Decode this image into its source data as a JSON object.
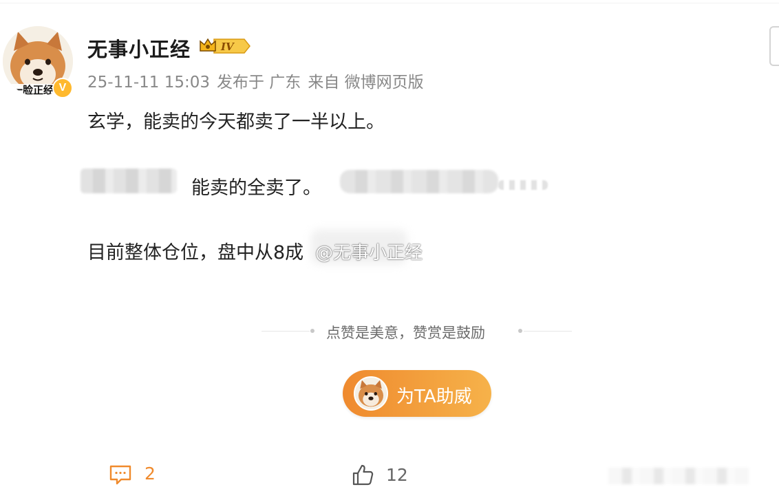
{
  "post": {
    "username": "无事小正经",
    "level_badge": "IV",
    "avatar_caption": "一脸正经",
    "verified_mark": "V",
    "meta": {
      "timestamp": "25-11-11 15:03",
      "location": "发布于 广东",
      "source": "来自 微博网页版"
    },
    "paragraphs": {
      "p1": "玄学，能卖的今天都卖了一半以上。",
      "p2": "能卖的全卖了。",
      "p3": "目前整体仓位，盘中从8成"
    },
    "watermark": "@无事小正经"
  },
  "reward": {
    "prompt": "点赞是美意，赞赏是鼓励",
    "button_label": "为TA助威"
  },
  "footer": {
    "comment_count": "2",
    "like_count": "12"
  },
  "colors": {
    "accent_orange": "#f08a2c",
    "badge_gold": "#ffb92e",
    "meta_gray": "#888888"
  },
  "icons": [
    "avatar-image",
    "verified-badge-icon",
    "crown-level-icon",
    "comment-icon",
    "thumbs-up-icon"
  ]
}
